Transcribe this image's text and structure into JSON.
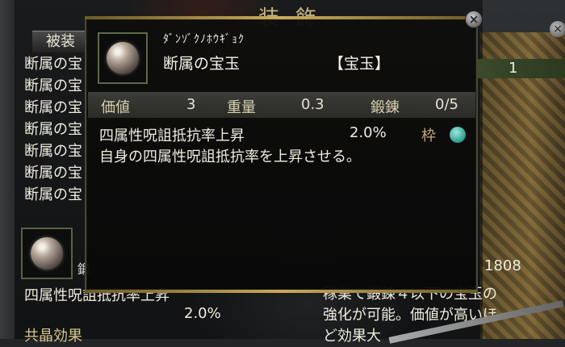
{
  "background": {
    "window_title": "装飾",
    "tab_label": "被装",
    "list_items": [
      "断属の宝",
      "断属の宝",
      "断属の宝",
      "断属の宝",
      "断属の宝",
      "断属の宝",
      "断属の宝"
    ],
    "count": "1",
    "money": "1808",
    "small_char": "鍛",
    "effect_text": "四属性呪詛抵抗率上昇",
    "effect_value": "2.0%",
    "joint_effect_label": "共晶効果",
    "desc_lines": [
      "稼業で鍛錬４以下の宝玉の",
      "強化が可能。価値が高いほ",
      "ど効果大"
    ]
  },
  "tooltip": {
    "close_glyph": "×",
    "reading": "ﾀﾞﾝｿﾞｸﾉﾎｳｷﾞｮｸ",
    "name": "断属の宝玉",
    "category": "【宝玉】",
    "icon": "orb-gem-icon",
    "stats": {
      "value_label": "価値",
      "value": "3",
      "weight_label": "重量",
      "weight": "0.3",
      "forge_label": "鍛錬",
      "forge": "0/5"
    },
    "effect": {
      "text": "四属性呪詛抵抗率上昇",
      "value": "2.0%",
      "slot_label": "枠",
      "slot_color": "#3aa89a"
    },
    "description": "自身の四属性呪詛抵抗率を上昇させる。"
  }
}
